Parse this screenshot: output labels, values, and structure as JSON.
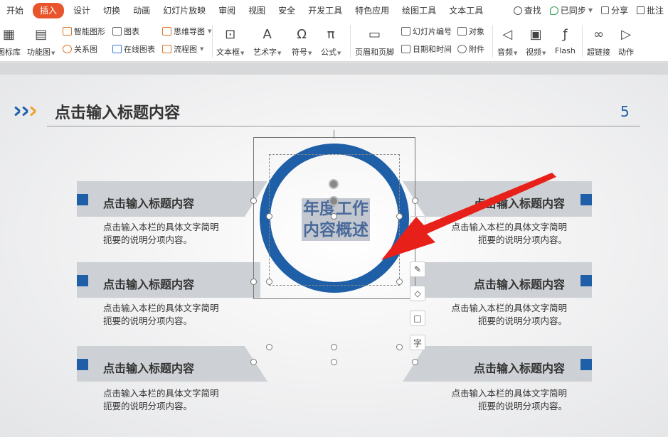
{
  "menu": {
    "tabs": [
      "开始",
      "插入",
      "设计",
      "切换",
      "动画",
      "幻灯片放映",
      "审阅",
      "视图",
      "安全",
      "开发工具",
      "特色应用",
      "绘图工具",
      "文本工具"
    ],
    "active_tab": "插入",
    "search": "查找",
    "sync": "已同步",
    "share": "分享",
    "comment": "批注"
  },
  "ribbon": {
    "icon_lib": "图标库",
    "func_chart": "功能图",
    "smart_art": "智能图形",
    "chart": "图表",
    "mind_map": "思维导图",
    "relation": "关系图",
    "online_chart": "在线图表",
    "flowchart": "流程图",
    "textbox": "文本框",
    "art_text": "艺术字",
    "symbol": "符号",
    "formula": "公式",
    "header_footer": "页眉和页脚",
    "slide_number": "幻灯片编号",
    "object": "对象",
    "date_time": "日期和时间",
    "attachment": "附件",
    "audio": "音频",
    "video": "视频",
    "flash": "Flash",
    "hyperlink": "超链接",
    "action": "动作"
  },
  "slide": {
    "title": "点击输入标题内容",
    "page_number": "5",
    "center_text_line1": "年度工作",
    "center_text_line2": "内容概述",
    "items": [
      {
        "title": "点击输入标题内容",
        "desc1": "点击输入本栏的具体文字简明",
        "desc2": "扼要的说明分项内容。"
      },
      {
        "title": "点击输入标题内容",
        "desc1": "点击输入本栏的具体文字简明",
        "desc2": "扼要的说明分项内容。"
      },
      {
        "title": "点击输入标题内容",
        "desc1": "点击输入本栏的具体文字简明",
        "desc2": "扼要的说明分项内容。"
      },
      {
        "title": "点击输入标题内容",
        "desc1": "点击输入本栏的具体文字简明",
        "desc2": "扼要的说明分项内容。"
      },
      {
        "title": "点击输入标题内容",
        "desc1": "点击输入本栏的具体文字简明",
        "desc2": "扼要的说明分项内容。"
      },
      {
        "title": "点击输入标题内容",
        "desc1": "点击输入本栏的具体文字简明",
        "desc2": "扼要的说明分项内容。"
      }
    ]
  },
  "float_tools": {
    "text_tool": "字"
  },
  "colors": {
    "accent_blue": "#1e5fa8",
    "accent_orange": "#f0a02a",
    "active_tab": "#e8542c",
    "arrow_red": "#e8201a"
  }
}
